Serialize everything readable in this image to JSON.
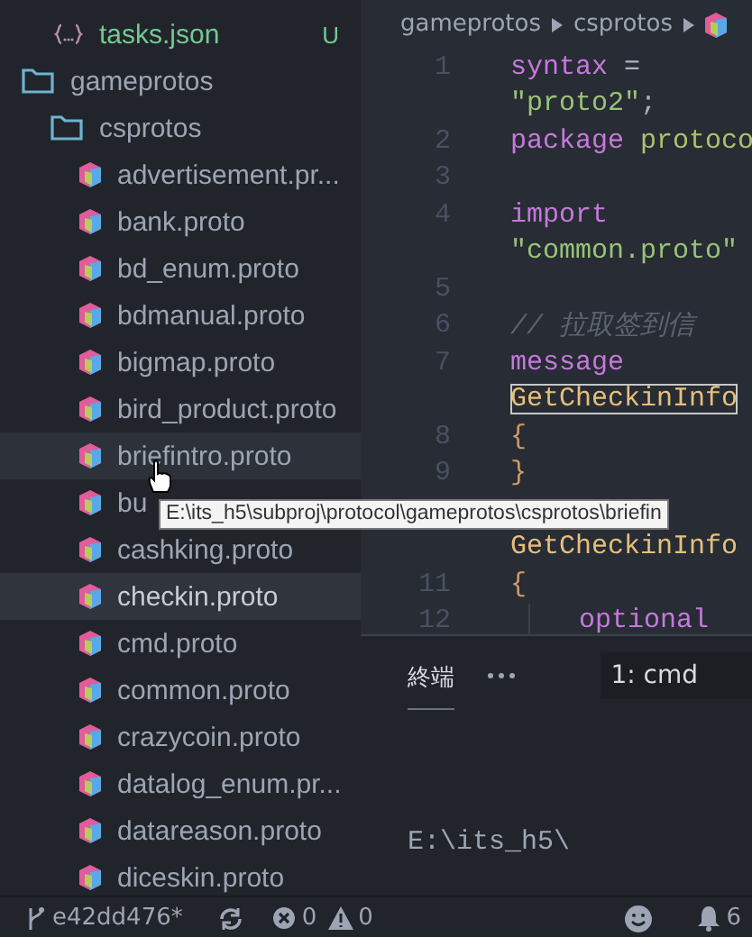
{
  "sidebar": {
    "tree": [
      {
        "label": "tasks.json",
        "kind": "json",
        "badge": "U",
        "selected": false,
        "hovered": false
      },
      {
        "label": "gameprotos",
        "kind": "folder",
        "selected": false,
        "hovered": false,
        "children": [
          {
            "label": "csprotos",
            "kind": "folder",
            "selected": false,
            "hovered": false,
            "children": [
              {
                "label": "advertisement.pr...",
                "kind": "proto",
                "selected": false,
                "hovered": false
              },
              {
                "label": "bank.proto",
                "kind": "proto",
                "selected": false,
                "hovered": false
              },
              {
                "label": "bd_enum.proto",
                "kind": "proto",
                "selected": false,
                "hovered": false
              },
              {
                "label": "bdmanual.proto",
                "kind": "proto",
                "selected": false,
                "hovered": false
              },
              {
                "label": "bigmap.proto",
                "kind": "proto",
                "selected": false,
                "hovered": false
              },
              {
                "label": "bird_product.proto",
                "kind": "proto",
                "selected": false,
                "hovered": false
              },
              {
                "label": "briefintro.proto",
                "kind": "proto",
                "selected": false,
                "hovered": true
              },
              {
                "label": "bu",
                "kind": "proto",
                "selected": false,
                "hovered": false
              },
              {
                "label": "cashking.proto",
                "kind": "proto",
                "selected": false,
                "hovered": false
              },
              {
                "label": "checkin.proto",
                "kind": "proto",
                "selected": true,
                "hovered": false
              },
              {
                "label": "cmd.proto",
                "kind": "proto",
                "selected": false,
                "hovered": false
              },
              {
                "label": "common.proto",
                "kind": "proto",
                "selected": false,
                "hovered": false
              },
              {
                "label": "crazycoin.proto",
                "kind": "proto",
                "selected": false,
                "hovered": false
              },
              {
                "label": "datalog_enum.pr...",
                "kind": "proto",
                "selected": false,
                "hovered": false
              },
              {
                "label": "datareason.proto",
                "kind": "proto",
                "selected": false,
                "hovered": false
              },
              {
                "label": "diceskin.proto",
                "kind": "proto",
                "selected": false,
                "hovered": false
              }
            ]
          }
        ]
      }
    ]
  },
  "tooltip": {
    "text": "E:\\its_h5\\subproj\\protocol\\gameprotos\\csprotos\\briefin"
  },
  "editor": {
    "breadcrumb": [
      "gameprotos",
      "csprotos"
    ],
    "rows": [
      {
        "number": "1",
        "tokens": [
          {
            "kind": "keyword",
            "text": "syntax"
          },
          {
            "kind": "plain",
            "text": " ="
          }
        ]
      },
      {
        "tokens": [
          {
            "kind": "string",
            "text": "\"proto2\""
          },
          {
            "kind": "plain",
            "text": ";"
          }
        ]
      },
      {
        "number": "2",
        "tokens": [
          {
            "kind": "keyword",
            "text": "package"
          },
          {
            "kind": "name",
            "text": " protoco"
          }
        ]
      },
      {
        "number": "3",
        "tokens": []
      },
      {
        "number": "4",
        "tokens": [
          {
            "kind": "keyword",
            "text": "import"
          }
        ]
      },
      {
        "tokens": [
          {
            "kind": "string",
            "text": "\"common.proto\""
          }
        ]
      },
      {
        "number": "5",
        "tokens": []
      },
      {
        "number": "6",
        "tokens": [
          {
            "kind": "comment",
            "text": "// 拉取签到信"
          }
        ]
      },
      {
        "number": "7",
        "tokens": [
          {
            "kind": "keyword",
            "text": "message"
          }
        ]
      },
      {
        "tokens": [
          {
            "kind": "highlight",
            "text": "GetCheckinInfo"
          }
        ]
      },
      {
        "number": "8",
        "tokens": [
          {
            "kind": "brace",
            "text": "{"
          }
        ]
      },
      {
        "number": "9",
        "tokens": [
          {
            "kind": "brace",
            "text": "}"
          }
        ]
      },
      {
        "tokens": []
      },
      {
        "tokens": [
          {
            "kind": "type",
            "text": "GetCheckinInfo"
          }
        ]
      },
      {
        "number": "11",
        "tokens": [
          {
            "kind": "brace",
            "text": "{"
          }
        ]
      },
      {
        "number": "12",
        "nested": true,
        "tokens": [
          {
            "kind": "keyword",
            "text": "optional"
          }
        ]
      }
    ]
  },
  "panel": {
    "tabs": [
      {
        "label": "終端",
        "selected": true
      }
    ],
    "terminal_select": "1: cmd",
    "output": "E:\\its_h5\\"
  },
  "status_bar": {
    "branch": "e42dd476*",
    "errors": "0",
    "warnings": "0",
    "notifications": "6"
  }
}
